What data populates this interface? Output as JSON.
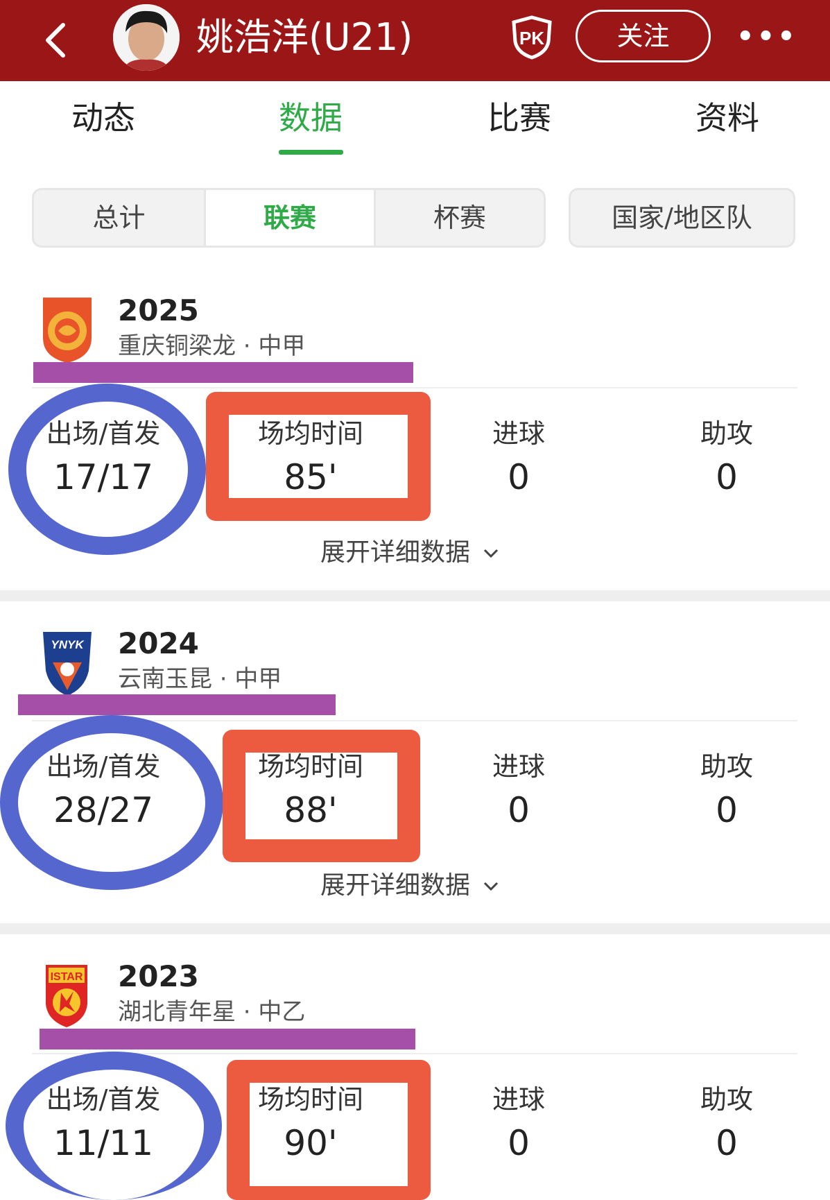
{
  "header": {
    "title": "姚浩洋(U21)",
    "pk_label": "PK",
    "follow_label": "关注",
    "more_label": "•••"
  },
  "tabs": [
    {
      "label": "动态",
      "active": false
    },
    {
      "label": "数据",
      "active": true
    },
    {
      "label": "比赛",
      "active": false
    },
    {
      "label": "资料",
      "active": false
    }
  ],
  "filters": [
    {
      "label": "总计",
      "active": false
    },
    {
      "label": "联赛",
      "active": true
    },
    {
      "label": "杯赛",
      "active": false
    }
  ],
  "national_filter": "国家/地区队",
  "stat_labels": {
    "apps": "出场/首发",
    "avg_time": "场均时间",
    "goals": "进球",
    "assists": "助攻"
  },
  "expand_label": "展开详细数据",
  "seasons": [
    {
      "year": "2025",
      "team": "重庆铜梁龙 · 中甲",
      "apps": "17/17",
      "avg_time": "85'",
      "goals": "0",
      "assists": "0"
    },
    {
      "year": "2024",
      "team": "云南玉昆 · 中甲",
      "apps": "28/27",
      "avg_time": "88'",
      "goals": "0",
      "assists": "0"
    },
    {
      "year": "2023",
      "team": "湖北青年星 · 中乙",
      "apps": "11/11",
      "avg_time": "90'",
      "goals": "0",
      "assists": "0"
    }
  ],
  "logo_text": {
    "s2024": "YNYK",
    "s2023": "ISTAR"
  },
  "colors": {
    "header_bg": "#9b1717",
    "accent_green": "#2eaa47",
    "annotation_blue": "#5567cf",
    "annotation_orange": "#ec5a40",
    "annotation_purple": "#a64fa8"
  }
}
